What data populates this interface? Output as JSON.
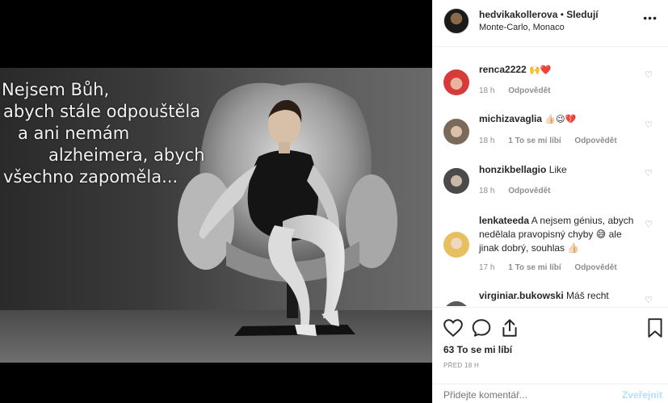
{
  "post": {
    "overlay_lines": [
      "Nejsem Bůh,",
      "abych stále odpouštěla",
      "a ani nemám",
      "alzheimera, abych",
      "všechno zapoměla..."
    ]
  },
  "header": {
    "username": "hedvikakollerova",
    "separator": "•",
    "follow_label": "Sledují",
    "location": "Monte-Carlo, Monaco",
    "more_icon": "•••"
  },
  "comments": [
    {
      "username": "renca2222",
      "text": "🙌❤️",
      "time": "18 h",
      "likes": "",
      "reply": "Odpovědět"
    },
    {
      "username": "michizavaglia",
      "text": "👍🏻😉💔",
      "time": "18 h",
      "likes": "1 To se mi líbí",
      "reply": "Odpovědět"
    },
    {
      "username": "honzikbellagio",
      "text": "Like",
      "time": "18 h",
      "likes": "",
      "reply": "Odpovědět"
    },
    {
      "username": "lenkateeda",
      "text": "A nejsem génius, abych nedělala pravopisný chyby 😅 ale jinak dobrý, souhlas 👍🏻",
      "time": "17 h",
      "likes": "1 To se mi líbí",
      "reply": "Odpovědět"
    },
    {
      "username": "virginiar.bukowski",
      "text": "Máš recht",
      "time": "",
      "likes": "",
      "reply": ""
    }
  ],
  "actions": {
    "likes": "63 To se mi líbí",
    "date": "PŘED 18 H",
    "comment_placeholder": "Přidejte komentář...",
    "post_label": "Zveřejnit"
  },
  "colors": {
    "accent_disabled": "#b2dffc",
    "heart_red": "#ed4956",
    "muted": "#8e8e8e"
  }
}
